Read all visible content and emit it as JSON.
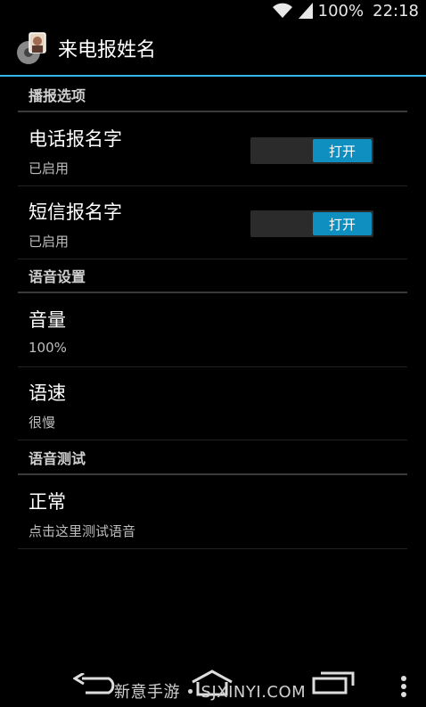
{
  "status": {
    "battery": "100%",
    "time": "22:18"
  },
  "app": {
    "title": "来电报姓名"
  },
  "sections": [
    {
      "header": "播报选项",
      "items": [
        {
          "title": "电话报名字",
          "summary": "已启用",
          "toggle": "打开"
        },
        {
          "title": "短信报名字",
          "summary": "已启用",
          "toggle": "打开"
        }
      ]
    },
    {
      "header": "语音设置",
      "items": [
        {
          "title": "音量",
          "summary": "100%"
        },
        {
          "title": "语速",
          "summary": "很慢"
        }
      ]
    },
    {
      "header": "语音测试",
      "items": [
        {
          "title": "正常",
          "summary": "点击这里测试语音"
        }
      ]
    }
  ],
  "watermark": "新意手游 • SJXINYI.COM",
  "colors": {
    "accent": "#33b5e5",
    "switch_on": "#0e8fc0",
    "background": "#000000"
  }
}
